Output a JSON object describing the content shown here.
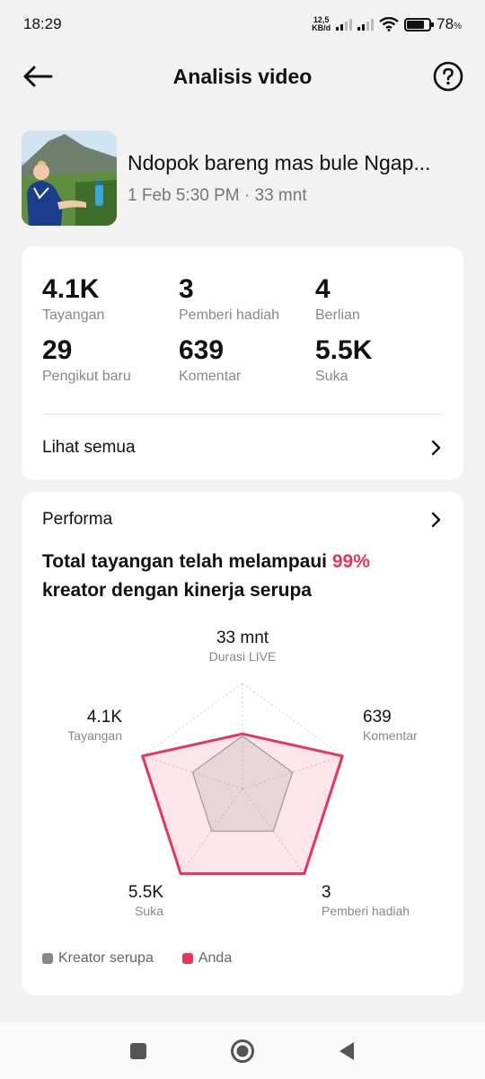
{
  "status_bar": {
    "time": "18:29",
    "net_speed_top": "12,5",
    "net_speed_bottom": "KB/d",
    "battery_pct": "78",
    "battery_level": 0.78
  },
  "header": {
    "title": "Analisis video"
  },
  "video": {
    "title": "Ndopok bareng mas bule Ngap...",
    "meta": "1 Feb 5:30 PM · 33 mnt"
  },
  "stats": [
    {
      "value": "4.1K",
      "label": "Tayangan"
    },
    {
      "value": "3",
      "label": "Pemberi hadiah"
    },
    {
      "value": "4",
      "label": "Berlian"
    },
    {
      "value": "29",
      "label": "Pengikut baru"
    },
    {
      "value": "639",
      "label": "Komentar"
    },
    {
      "value": "5.5K",
      "label": "Suka"
    }
  ],
  "see_all_label": "Lihat semua",
  "performance": {
    "title": "Performa",
    "headline_pre": "Total tayangan telah melampaui ",
    "headline_pct": "99%",
    "headline_post": "kreator dengan kinerja serupa",
    "axes": [
      {
        "value": "33 mnt",
        "name": "Durasi LIVE"
      },
      {
        "value": "639",
        "name": "Komentar"
      },
      {
        "value": "3",
        "name": "Pemberi hadiah"
      },
      {
        "value": "5.5K",
        "name": "Suka"
      },
      {
        "value": "4.1K",
        "name": "Tayangan"
      }
    ],
    "similar_levels": [
      0.5,
      0.5,
      0.5,
      0.5,
      0.5
    ],
    "you_levels": [
      0.52,
      1.0,
      1.0,
      1.0,
      1.0
    ],
    "legend": [
      {
        "label": "Kreator serupa",
        "color": "#888888"
      },
      {
        "label": "Anda",
        "color": "#e8345a"
      }
    ]
  }
}
